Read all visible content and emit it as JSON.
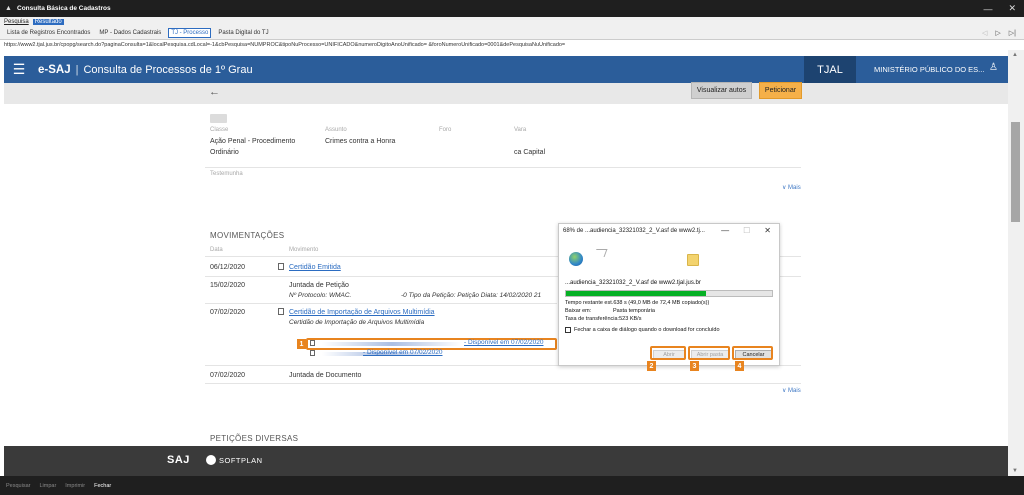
{
  "window": {
    "title": "Consulta Básica de Cadastros",
    "controls": [
      "—",
      "✕"
    ]
  },
  "menubar": {
    "items": [
      {
        "label": "Pesquisa",
        "active": false
      },
      {
        "label": "Resultado",
        "active": true
      }
    ]
  },
  "tabs": [
    {
      "label": "Lista de Registros Encontrados",
      "selected": false
    },
    {
      "label": "MP - Dados Cadastrais",
      "selected": false
    },
    {
      "label": "TJ - Processo",
      "selected": true
    },
    {
      "label": "Pasta Digital do TJ",
      "selected": false
    }
  ],
  "nav_buttons": [
    "◁",
    "▷",
    "▷|"
  ],
  "url": "https://www2.tjal.jus.br/cpopg/search.do?paginaConsulta=1&localPesquisa.cdLocal=-1&cbPesquisa=NUMPROC&tipoNuProcesso=UNIFICADO&numeroDigitoAnoUnificado=                              &foroNumeroUnificado=0001&dePesquisaNuUnificado=",
  "esaj": {
    "menu_icon": "☰",
    "brand": "e-SAJ",
    "separator": "|",
    "page_title": "Consulta de Processos de 1º Grau",
    "court": "TJAL",
    "organization": "MINISTÉRIO PÚBLICO DO ES...",
    "user_icon": "user-icon",
    "user_glyph": "♙"
  },
  "actions": {
    "back_glyph": "←",
    "view_files": "Visualizar autos",
    "petition": "Peticionar"
  },
  "case": {
    "labels": {
      "class": "Classe",
      "subject": "Assunto",
      "forum": "Foro",
      "court": "Vara"
    },
    "class_value_1": "Ação Penal - Procedimento",
    "class_value_2": "Ordinário",
    "subject_value": "Crimes contra a Honra",
    "court_value": "ca Capital",
    "witness_label": "Testemunha",
    "more_label": "∨ Mais"
  },
  "movements": {
    "title": "MOVIMENTAÇÕES",
    "col_date": "Data",
    "col_movement": "Movimento",
    "rows": [
      {
        "date": "06/12/2020",
        "link": "Certidão Emitida"
      },
      {
        "date": "15/02/2020",
        "text": "Juntada de Petição",
        "sub": "Nº Protocolo: WMAC.",
        "sub2": "-0 Tipo da Petição: Petição Diata: 14/02/2020 21"
      },
      {
        "date": "07/02/2020",
        "link": "Certidão de Importação de Arquivos Multimídia",
        "sub": "Certidão de Importação de Arquivos Multimídia"
      },
      {
        "date": "07/02/2020",
        "text": "Juntada de Documento"
      }
    ],
    "files": [
      {
        "text": "- Disponível em 07/02/2020"
      },
      {
        "text": "- Disponível em 07/02/2020"
      }
    ],
    "more_label": "∨ Mais"
  },
  "petitions": {
    "title": "PETIÇÕES DIVERSAS"
  },
  "footer": {
    "saj": "SAJ",
    "softplan": "SOFTPLAN"
  },
  "badges": [
    "1",
    "2",
    "3",
    "4"
  ],
  "download": {
    "title": "68% de ...audiencia_32321032_2_V.asf de www2.tj...",
    "controls": [
      "—",
      "☐",
      "✕"
    ],
    "filename": "...audiencia_32321032_2_V.asf de www2.tjal.jus.br",
    "progress": 0.68,
    "remaining_label": "Tempo restante est.",
    "remaining_value": "638 s (49,0 MB de 72,4 MB copiado(s))",
    "download_to_label": "Baixar em:",
    "download_to_value": "Pasta temporária",
    "rate_label": "Taxa de transferência:",
    "rate_value": "523 KB/s",
    "close_checkbox": "Fechar a caixa de diálogo quando o download for concluído",
    "open_btn": "Abrir",
    "open_folder_btn": "Abrir pasta",
    "cancel_btn": "Cancelar"
  },
  "statusbar": {
    "commands": [
      {
        "label": "Pesquisar",
        "enabled": false
      },
      {
        "label": "Limpar",
        "enabled": false
      },
      {
        "label": "Imprimir",
        "enabled": false
      },
      {
        "label": "Fechar",
        "enabled": true
      }
    ]
  },
  "colors": {
    "esaj_blue": "#2b5d9a",
    "tjal_dark": "#1d4370",
    "petition_orange": "#f5b049",
    "highlight_orange": "#e8841f",
    "progress_green": "#06b025",
    "link_blue": "#2b6cc1"
  }
}
